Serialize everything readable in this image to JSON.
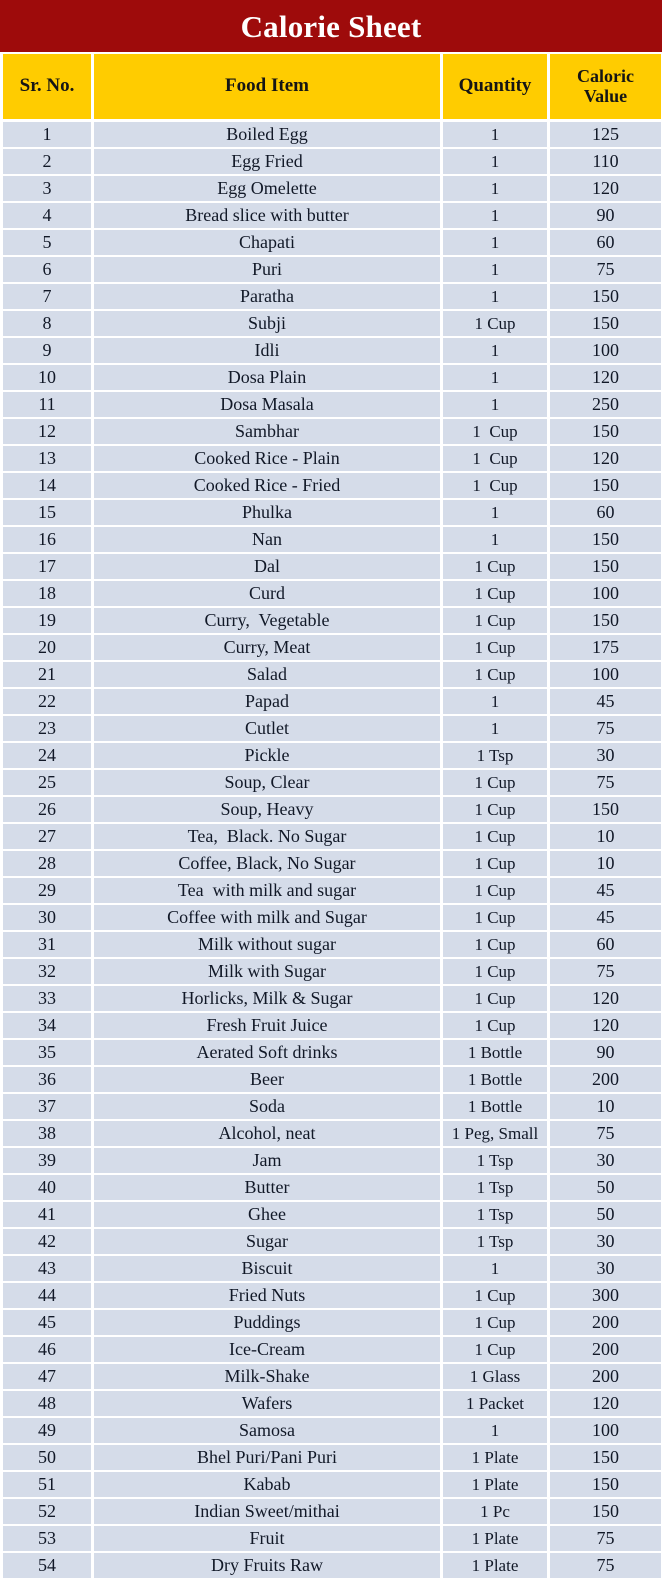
{
  "document": {
    "title": "Calorie Sheet",
    "title_bar_color": "#9e0b0b",
    "header_color": "#ffcc00",
    "cell_color": "#d5dce9"
  },
  "table": {
    "columns": [
      "Sr. No.",
      "Food Item",
      "Quantity",
      "Caloric Value"
    ],
    "caloric_header_line1": "Caloric",
    "caloric_header_line2": "Value",
    "rows": [
      {
        "sr": "1",
        "food": "Boiled Egg",
        "qty": "1",
        "cal": "125"
      },
      {
        "sr": "2",
        "food": "Egg Fried",
        "qty": "1",
        "cal": "110"
      },
      {
        "sr": "3",
        "food": "Egg Omelette",
        "qty": "1",
        "cal": "120"
      },
      {
        "sr": "4",
        "food": "Bread slice with butter",
        "qty": "1",
        "cal": "90"
      },
      {
        "sr": "5",
        "food": "Chapati",
        "qty": "1",
        "cal": "60"
      },
      {
        "sr": "6",
        "food": "Puri",
        "qty": "1",
        "cal": "75"
      },
      {
        "sr": "7",
        "food": "Paratha",
        "qty": "1",
        "cal": "150"
      },
      {
        "sr": "8",
        "food": "Subji",
        "qty": "1 Cup",
        "cal": "150"
      },
      {
        "sr": "9",
        "food": "Idli",
        "qty": "1",
        "cal": "100"
      },
      {
        "sr": "10",
        "food": "Dosa Plain",
        "qty": "1",
        "cal": "120"
      },
      {
        "sr": "11",
        "food": "Dosa Masala",
        "qty": "1",
        "cal": "250"
      },
      {
        "sr": "12",
        "food": "Sambhar",
        "qty": "1  Cup",
        "cal": "150"
      },
      {
        "sr": "13",
        "food": "Cooked Rice - Plain",
        "qty": "1  Cup",
        "cal": "120"
      },
      {
        "sr": "14",
        "food": "Cooked Rice - Fried",
        "qty": "1  Cup",
        "cal": "150"
      },
      {
        "sr": "15",
        "food": "Phulka",
        "qty": "1",
        "cal": "60"
      },
      {
        "sr": "16",
        "food": "Nan",
        "qty": "1",
        "cal": "150"
      },
      {
        "sr": "17",
        "food": "Dal",
        "qty": "1 Cup",
        "cal": "150"
      },
      {
        "sr": "18",
        "food": "Curd",
        "qty": "1 Cup",
        "cal": "100"
      },
      {
        "sr": "19",
        "food": "Curry,  Vegetable",
        "qty": "1 Cup",
        "cal": "150"
      },
      {
        "sr": "20",
        "food": "Curry, Meat",
        "qty": "1 Cup",
        "cal": "175"
      },
      {
        "sr": "21",
        "food": "Salad",
        "qty": "1 Cup",
        "cal": "100"
      },
      {
        "sr": "22",
        "food": "Papad",
        "qty": "1",
        "cal": "45"
      },
      {
        "sr": "23",
        "food": "Cutlet",
        "qty": "1",
        "cal": "75"
      },
      {
        "sr": "24",
        "food": "Pickle",
        "qty": "1 Tsp",
        "cal": "30"
      },
      {
        "sr": "25",
        "food": "Soup, Clear",
        "qty": "1 Cup",
        "cal": "75"
      },
      {
        "sr": "26",
        "food": "Soup, Heavy",
        "qty": "1 Cup",
        "cal": "150"
      },
      {
        "sr": "27",
        "food": "Tea,  Black. No Sugar",
        "qty": "1 Cup",
        "cal": "10"
      },
      {
        "sr": "28",
        "food": "Coffee, Black, No Sugar",
        "qty": "1 Cup",
        "cal": "10"
      },
      {
        "sr": "29",
        "food": "Tea  with milk and sugar",
        "qty": "1 Cup",
        "cal": "45"
      },
      {
        "sr": "30",
        "food": "Coffee with milk and Sugar",
        "qty": "1 Cup",
        "cal": "45"
      },
      {
        "sr": "31",
        "food": "Milk without sugar",
        "qty": "1 Cup",
        "cal": "60"
      },
      {
        "sr": "32",
        "food": "Milk with Sugar",
        "qty": "1 Cup",
        "cal": "75"
      },
      {
        "sr": "33",
        "food": "Horlicks, Milk & Sugar",
        "qty": "1 Cup",
        "cal": "120"
      },
      {
        "sr": "34",
        "food": "Fresh Fruit Juice",
        "qty": "1 Cup",
        "cal": "120"
      },
      {
        "sr": "35",
        "food": "Aerated Soft drinks",
        "qty": "1 Bottle",
        "cal": "90"
      },
      {
        "sr": "36",
        "food": "Beer",
        "qty": "1 Bottle",
        "cal": "200"
      },
      {
        "sr": "37",
        "food": "Soda",
        "qty": "1 Bottle",
        "cal": "10"
      },
      {
        "sr": "38",
        "food": "Alcohol, neat",
        "qty": "1 Peg, Small",
        "cal": "75"
      },
      {
        "sr": "39",
        "food": "Jam",
        "qty": "1 Tsp",
        "cal": "30"
      },
      {
        "sr": "40",
        "food": "Butter",
        "qty": "1 Tsp",
        "cal": "50"
      },
      {
        "sr": "41",
        "food": "Ghee",
        "qty": "1 Tsp",
        "cal": "50"
      },
      {
        "sr": "42",
        "food": "Sugar",
        "qty": "1 Tsp",
        "cal": "30"
      },
      {
        "sr": "43",
        "food": "Biscuit",
        "qty": "1",
        "cal": "30"
      },
      {
        "sr": "44",
        "food": "Fried Nuts",
        "qty": "1 Cup",
        "cal": "300"
      },
      {
        "sr": "45",
        "food": "Puddings",
        "qty": "1 Cup",
        "cal": "200"
      },
      {
        "sr": "46",
        "food": "Ice-Cream",
        "qty": "1 Cup",
        "cal": "200"
      },
      {
        "sr": "47",
        "food": "Milk-Shake",
        "qty": "1 Glass",
        "cal": "200"
      },
      {
        "sr": "48",
        "food": "Wafers",
        "qty": "1 Packet",
        "cal": "120"
      },
      {
        "sr": "49",
        "food": "Samosa",
        "qty": "1",
        "cal": "100"
      },
      {
        "sr": "50",
        "food": "Bhel Puri/Pani Puri",
        "qty": "1 Plate",
        "cal": "150"
      },
      {
        "sr": "51",
        "food": "Kabab",
        "qty": "1 Plate",
        "cal": "150"
      },
      {
        "sr": "52",
        "food": "Indian Sweet/mithai",
        "qty": "1 Pc",
        "cal": "150"
      },
      {
        "sr": "53",
        "food": "Fruit",
        "qty": "1 Plate",
        "cal": "75"
      },
      {
        "sr": "54",
        "food": "Dry Fruits Raw",
        "qty": "1 Plate",
        "cal": "75"
      }
    ]
  }
}
